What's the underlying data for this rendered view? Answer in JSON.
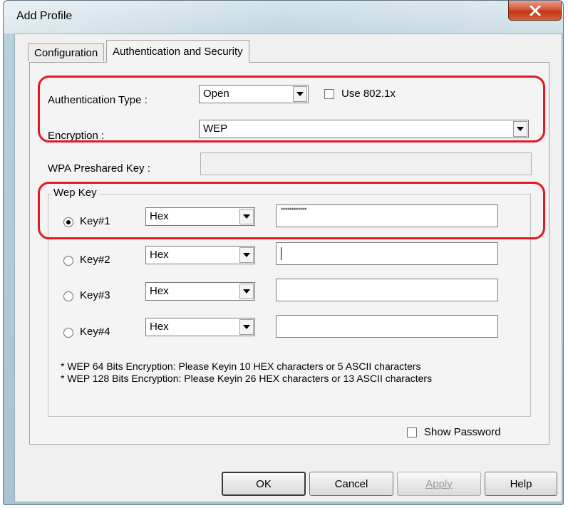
{
  "window": {
    "title": "Add Profile"
  },
  "tabs": [
    {
      "label": "Configuration",
      "active": false
    },
    {
      "label": "Authentication and Security",
      "active": true
    }
  ],
  "auth": {
    "type_label": "Authentication Type :",
    "type_value": "Open",
    "use8021x_label": "Use 802.1x",
    "use8021x_checked": false,
    "encryption_label": "Encryption :",
    "encryption_value": "WEP",
    "wpa_label": "WPA Preshared Key :",
    "wpa_value": ""
  },
  "wep": {
    "group_title": "Wep Key",
    "keys": [
      {
        "label": "Key#1",
        "format": "Hex",
        "value": "************",
        "selected": true
      },
      {
        "label": "Key#2",
        "format": "Hex",
        "value": "",
        "selected": false
      },
      {
        "label": "Key#3",
        "format": "Hex",
        "value": "",
        "selected": false
      },
      {
        "label": "Key#4",
        "format": "Hex",
        "value": "",
        "selected": false
      }
    ],
    "note1": "* WEP 64 Bits Encryption:  Please Keyin 10 HEX characters or 5 ASCII characters",
    "note2": "* WEP 128 Bits Encryption:  Please Keyin 26 HEX characters or 13 ASCII characters"
  },
  "show_password": {
    "label": "Show Password",
    "checked": false
  },
  "buttons": {
    "ok": "OK",
    "cancel": "Cancel",
    "apply": "Apply",
    "help": "Help"
  },
  "colors": {
    "highlight": "#e01a22",
    "close_button": "#c23513"
  }
}
